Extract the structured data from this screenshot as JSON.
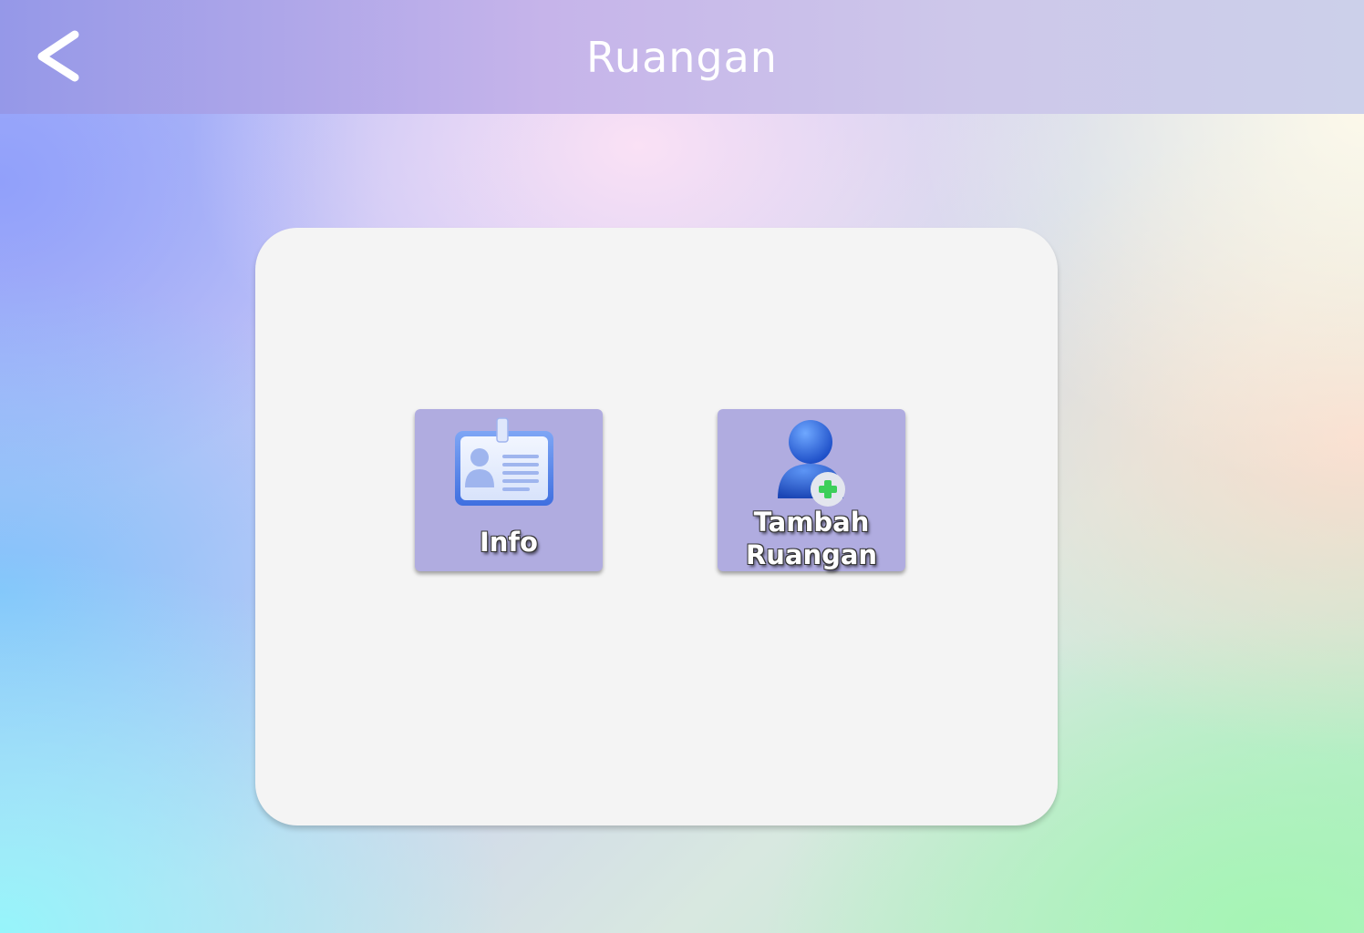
{
  "header": {
    "title": "Ruangan",
    "back_icon": "chevron-left-icon"
  },
  "menu": {
    "tiles": [
      {
        "label": "Info",
        "icon": "id-card-icon"
      },
      {
        "label": "Tambah\nRuangan",
        "label_line1": "Tambah",
        "label_line2": "Ruangan",
        "icon": "add-user-icon"
      }
    ]
  },
  "colors": {
    "header_gradient_start": "#9598e8",
    "header_gradient_end": "#ccd0ea",
    "panel": "#f4f4f4",
    "tile": "#b0ace0",
    "add_accent": "#3ccf5a"
  }
}
